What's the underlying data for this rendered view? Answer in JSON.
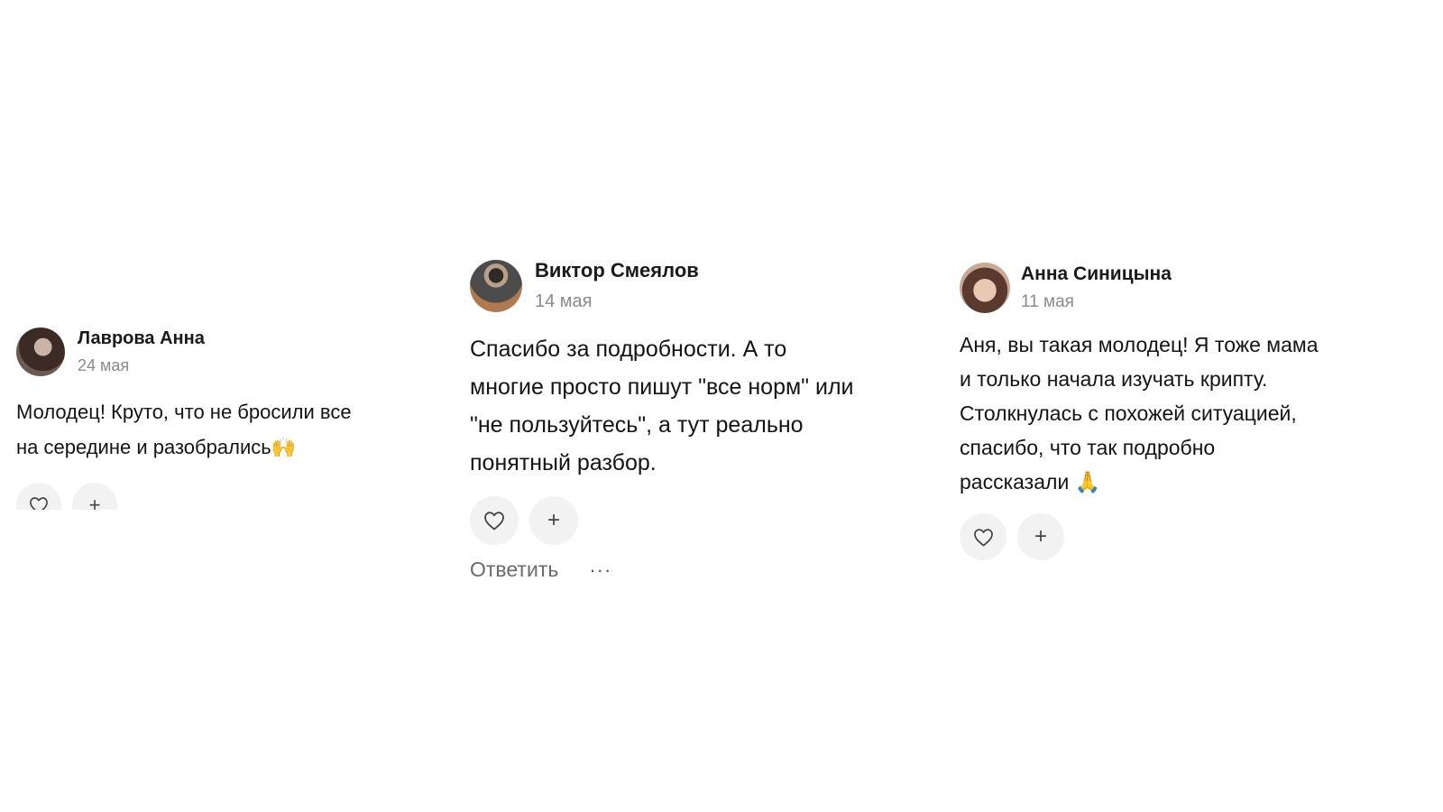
{
  "comments": [
    {
      "author": "Лаврова Анна",
      "date": "24 мая",
      "text": "Молодец! Круто, что не бросили все\nна середине и разобрались🙌",
      "plus": "+"
    },
    {
      "author": "Виктор Смеялов",
      "date": "14 мая",
      "text": "Спасибо за подробности. А то\nмногие просто пишут \"все норм\" или\n\"не пользуйтесь\", а тут реально\nпонятный разбор.",
      "plus": "+",
      "reply": "Ответить",
      "more": "···"
    },
    {
      "author": "Анна Синицына",
      "date": "11 мая",
      "text": "Аня, вы такая молодец! Я тоже мама\nи только начала изучать крипту.\nСтолкнулась с похожей ситуацией,\nспасибо, что так подробно\nрассказали 🙏",
      "plus": "+"
    }
  ],
  "icons": {
    "heart": "heart-outline-icon",
    "plus": "plus-icon",
    "more": "more-horizontal-icon"
  }
}
